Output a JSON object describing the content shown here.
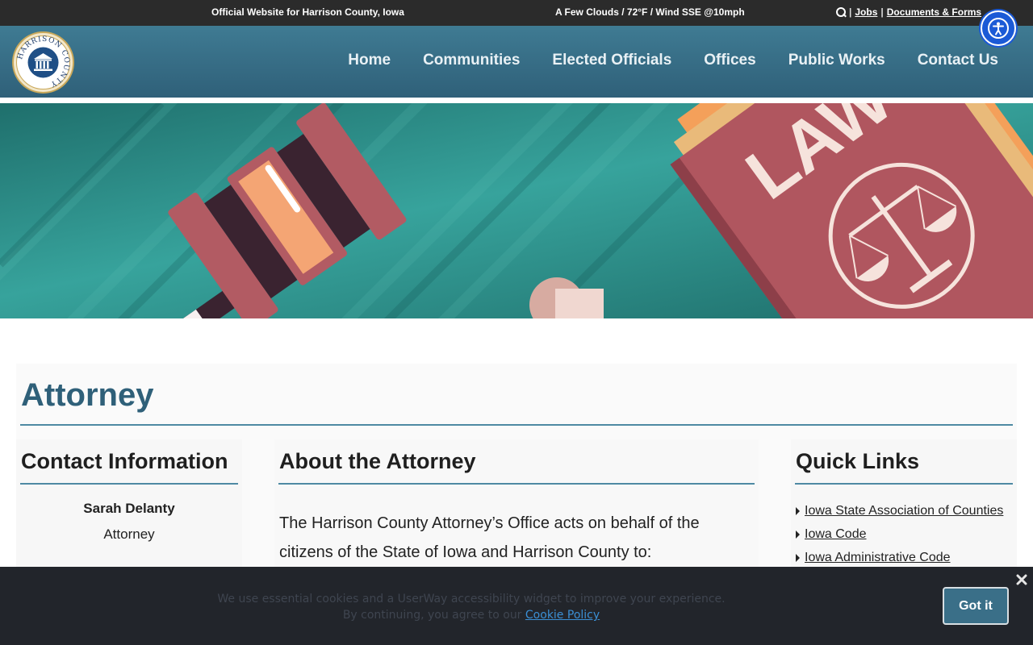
{
  "topbar": {
    "site_label": "Official Website for Harrison County, Iowa",
    "weather": "A Few Clouds / 72°F / Wind SSE @10mph",
    "sep1": "|",
    "jobs": "Jobs",
    "sep2": "|",
    "documents": "Documents & Forms"
  },
  "logo": {
    "text": "HARRISON COUNTY"
  },
  "nav": {
    "items": [
      "Home",
      "Communities",
      "Elected Officials",
      "Offices",
      "Public Works",
      "Contact Us"
    ]
  },
  "hero": {
    "book_text": "LAW"
  },
  "page": {
    "title": "Attorney"
  },
  "contact": {
    "heading": "Contact Information",
    "name": "Sarah Delanty",
    "role": "Attorney"
  },
  "about": {
    "heading": "About the Attorney",
    "text": "The Harrison County Attorney’s Office acts on behalf of the citizens of the State of Iowa and Harrison County to:"
  },
  "quick_links": {
    "heading": "Quick Links",
    "items": [
      "Iowa State Association of Counties",
      "Iowa Code",
      "Iowa Administrative Code"
    ]
  },
  "cookie": {
    "line1": "We use essential cookies and a UserWay accessibility widget to improve your experience.",
    "line2_prefix": "By continuing, you agree to our ",
    "policy_link": "Cookie Policy",
    "button": "Got it"
  },
  "colors": {
    "nav_bg": "#2f6079",
    "accent": "#2f6079",
    "a11y_blue": "#1b5ad6",
    "hero_teal": "#2f8e8a",
    "book_red": "#b0565f"
  }
}
